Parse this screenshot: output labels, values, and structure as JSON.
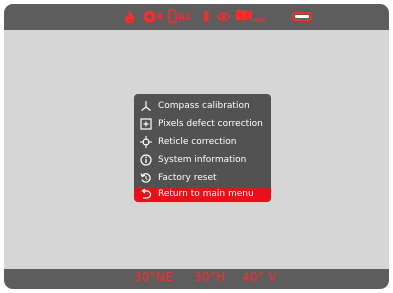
{
  "colors": {
    "accent": "#ff2a2a",
    "selected_bg": "#e9101b",
    "bar_bg": "#5d5d5d",
    "screen_bg": "#d6d6d6",
    "menu_bg": "#525252",
    "menu_text": "#ffffff"
  },
  "status_bar": {
    "icons": [
      "flame-icon",
      "gear-mode-icon",
      "document-g1-icon",
      "bluetooth-icon",
      "eye-icon",
      "video-out-icon",
      "battery-icon"
    ],
    "mode_label": "B",
    "profile_label": "G1",
    "video_sub_label": "OUT"
  },
  "menu": {
    "items": [
      {
        "label": "Compass calibration",
        "icon": "compass-axes-icon",
        "selected": false
      },
      {
        "label": "Pixels defect correction",
        "icon": "pixel-plus-icon",
        "selected": false
      },
      {
        "label": "Reticle correction",
        "icon": "reticle-crosshair-icon",
        "selected": false
      },
      {
        "label": "System information",
        "icon": "info-circle-icon",
        "selected": false
      },
      {
        "label": "Factory reset",
        "icon": "reset-arrow-icon",
        "selected": false
      },
      {
        "label": "Return to main menu",
        "icon": "return-arrow-icon",
        "selected": true
      }
    ]
  },
  "bottom_bar": {
    "heading": "30°NE",
    "horizontal": "30°H",
    "vertical": "40° V"
  }
}
